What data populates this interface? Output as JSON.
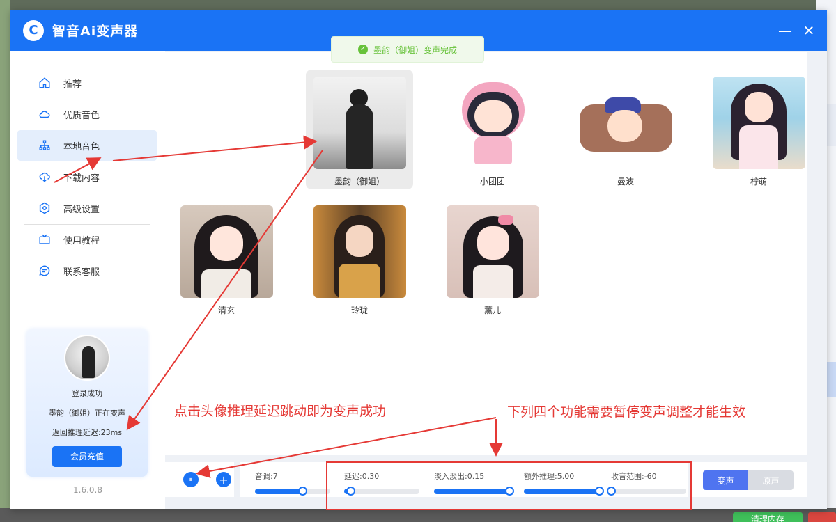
{
  "app": {
    "title": "智音Ai变声器",
    "logo": "C",
    "minimize": "—",
    "close": "✕"
  },
  "sidebar": {
    "items": [
      {
        "label": "推荐",
        "icon": "home-icon"
      },
      {
        "label": "优质音色",
        "icon": "cloud-icon"
      },
      {
        "label": "本地音色",
        "icon": "network-icon",
        "active": true
      },
      {
        "label": "下载内容",
        "icon": "download-icon"
      },
      {
        "label": "高级设置",
        "icon": "settings-icon"
      },
      {
        "label": "使用教程",
        "icon": "tv-icon"
      },
      {
        "label": "联系客服",
        "icon": "chat-icon"
      }
    ],
    "user": {
      "status": "登录成功",
      "current": "墨韵（御姐）正在变声",
      "latency": "返回推理延迟:23ms",
      "vip_button": "会员充值"
    },
    "version": "1.6.0.8"
  },
  "toast": {
    "text": "墨韵（御姐）变声完成",
    "icon": "✓"
  },
  "voices": [
    {
      "name": "墨韵（御姐）",
      "selected": true
    },
    {
      "name": "小团团"
    },
    {
      "name": "曼波"
    },
    {
      "name": "柠萌"
    },
    {
      "name": "清玄"
    },
    {
      "name": "玲珑"
    },
    {
      "name": "薰儿"
    }
  ],
  "controls": {
    "pause": "⏸",
    "add": "+",
    "sliders": [
      {
        "label": "音调:7",
        "value": 0.63
      },
      {
        "label": "延迟:0.30",
        "value": 0.08
      },
      {
        "label": "淡入淡出:0.15",
        "value": 1.0
      },
      {
        "label": "额外推理:5.00",
        "value": 1.0
      },
      {
        "label": "收音范围:-60",
        "value": 0.0
      }
    ],
    "mode_on": "变声",
    "mode_off": "原声"
  },
  "annotations": {
    "left": "点击头像推理延迟跳动即为变声成功",
    "right": "下列四个功能需要暂停变声调整才能生效"
  },
  "colors": {
    "accent": "#1a73f5",
    "annotation": "#e53935",
    "success": "#67c23a"
  },
  "background": {
    "clean_button": "清理内存"
  }
}
